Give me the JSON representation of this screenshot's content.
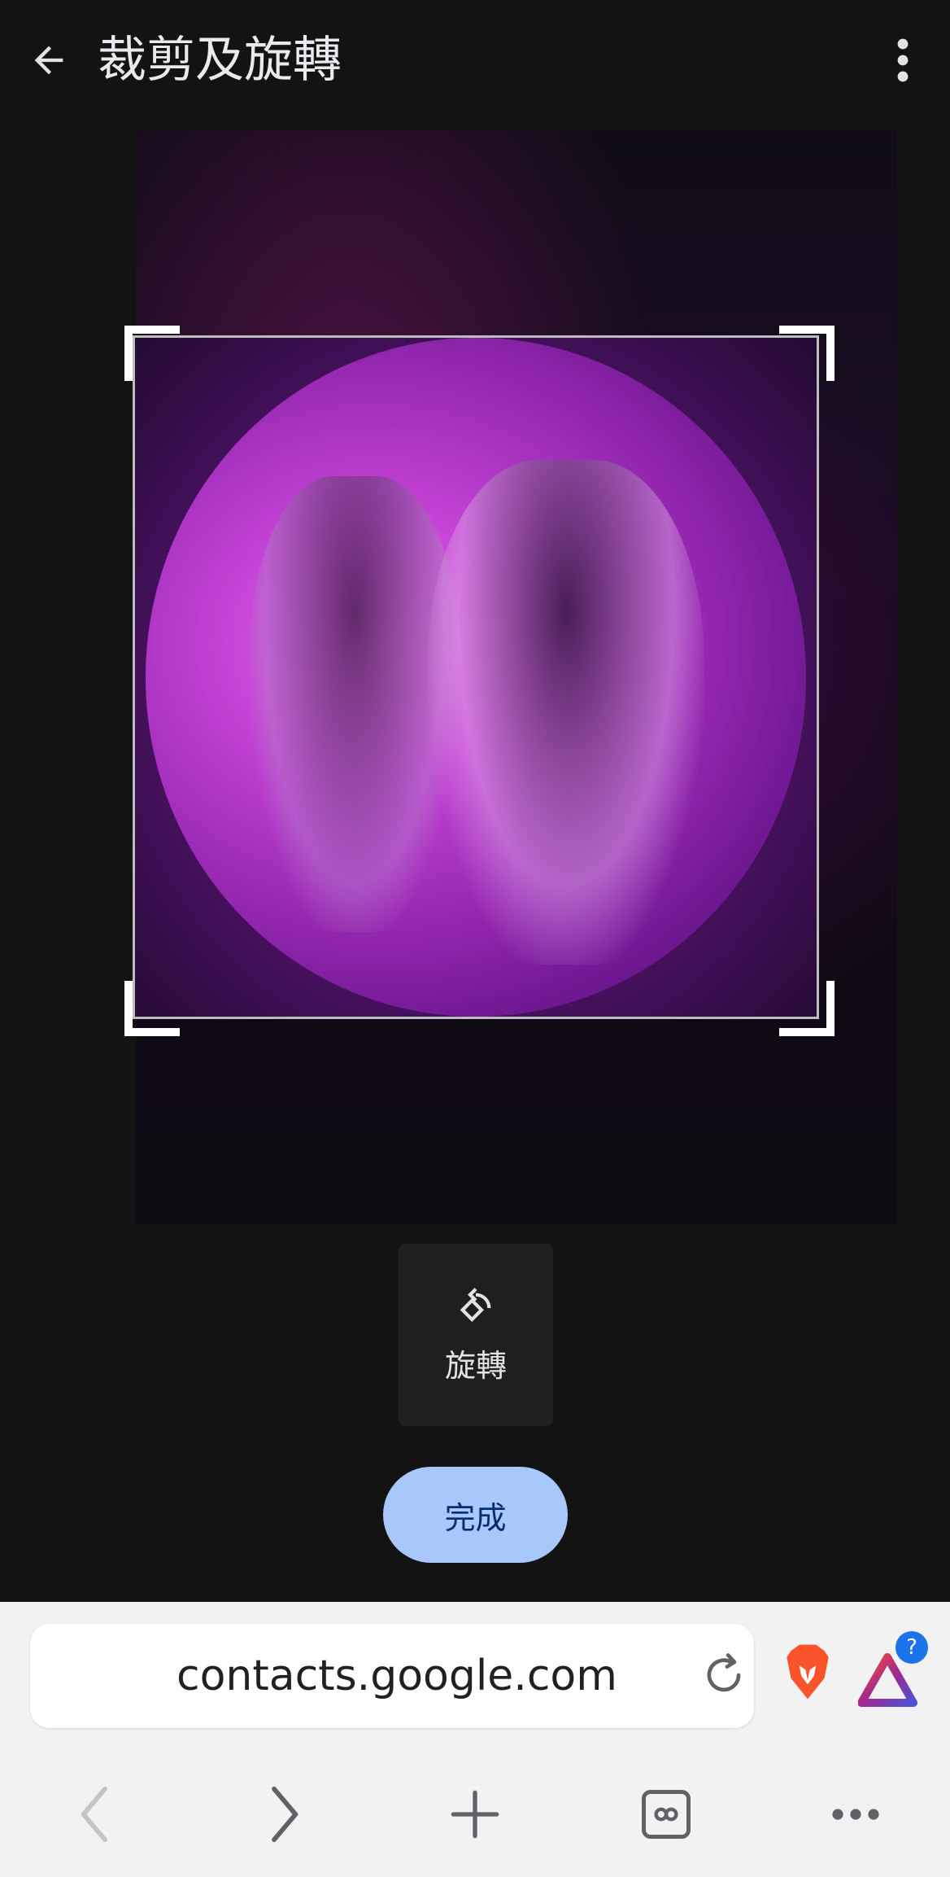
{
  "header": {
    "title": "裁剪及旋轉"
  },
  "editor": {
    "rotate_label": "旋轉",
    "done_label": "完成"
  },
  "browser": {
    "url": "contacts.google.com",
    "rewards_badge": "?"
  },
  "colors": {
    "background": "#131314",
    "done_button": "#a8c7fa",
    "done_text": "#062e6f",
    "browser_bar": "#f2f2f2",
    "brave_orange": "#fb542b"
  }
}
